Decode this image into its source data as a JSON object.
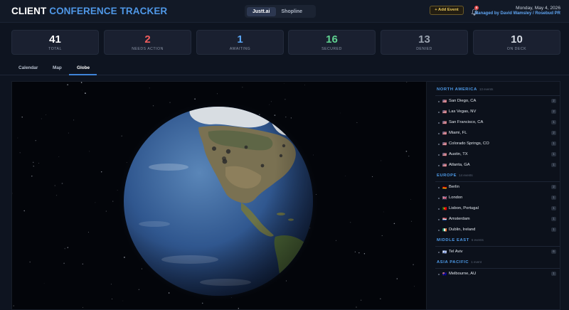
{
  "header": {
    "title_part1": "CLIENT",
    "title_part2": "CONFERENCE TRACKER",
    "workspaces": [
      "Justt.ai",
      "Shopline"
    ],
    "active_workspace": "Justt.ai",
    "add_event_label": "+ Add Event",
    "notification_count": "5",
    "date": "Monday, May 4, 2026",
    "manager": "Managed by David Wamsley / Rosebud PR"
  },
  "stats": [
    {
      "value": "41",
      "label": "TOTAL"
    },
    {
      "value": "2",
      "label": "NEEDS ACTION"
    },
    {
      "value": "1",
      "label": "AWAITING"
    },
    {
      "value": "16",
      "label": "SECURED"
    },
    {
      "value": "13",
      "label": "DENIED"
    },
    {
      "value": "10",
      "label": "ON DECK"
    }
  ],
  "tabs": [
    "Calendar",
    "Map",
    "Globe"
  ],
  "active_tab": "Globe",
  "regions": [
    {
      "name": "NORTH AMERICA",
      "count": "13 events",
      "cities": [
        {
          "name": "San Diego, CA",
          "flag": "🇺🇸",
          "count": "2"
        },
        {
          "name": "Las Vegas, NV",
          "flag": "🇺🇸",
          "count": "2"
        },
        {
          "name": "San Francisco, CA",
          "flag": "🇺🇸",
          "count": "1"
        },
        {
          "name": "Miami, FL",
          "flag": "🇺🇸",
          "count": "2"
        },
        {
          "name": "Colorado Springs, CO",
          "flag": "🇺🇸",
          "count": "1"
        },
        {
          "name": "Austin, TX",
          "flag": "🇺🇸",
          "count": "1"
        },
        {
          "name": "Atlanta, GA",
          "flag": "🇺🇸",
          "count": "1"
        }
      ]
    },
    {
      "name": "EUROPE",
      "count": "14 events",
      "cities": [
        {
          "name": "Berlin",
          "flag": "🇩🇪",
          "count": "2"
        },
        {
          "name": "London",
          "flag": "🇬🇧",
          "count": "1"
        },
        {
          "name": "Lisbon, Portugal",
          "flag": "🇵🇹",
          "count": "1"
        },
        {
          "name": "Amsterdam",
          "flag": "🇳🇱",
          "count": "1"
        },
        {
          "name": "Dublin, Ireland",
          "flag": "🇮🇪",
          "count": "1"
        }
      ]
    },
    {
      "name": "MIDDLE EAST",
      "count": "6 events",
      "cities": [
        {
          "name": "Tel Aviv",
          "flag": "🇮🇱",
          "count": "6"
        }
      ]
    },
    {
      "name": "ASIA PACIFIC",
      "count": "1 event",
      "cities": [
        {
          "name": "Melbourne, AU",
          "flag": "🇦🇺",
          "count": "1"
        }
      ]
    }
  ],
  "colors": {
    "accent_blue": "#4f97e6",
    "needs_action": "#ef5d5d",
    "secured": "#5fd190",
    "add_event": "#e7c75a"
  }
}
